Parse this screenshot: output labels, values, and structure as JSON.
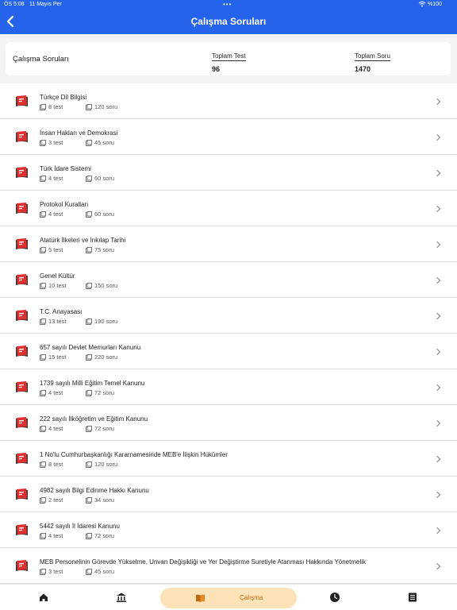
{
  "status_bar": {
    "time": "ÖS 5:08",
    "date": "11 Mayıs Per",
    "battery": "%100"
  },
  "header": {
    "title": "Çalışma Soruları"
  },
  "summary": {
    "title": "Çalışma Soruları",
    "total_test_label": "Toplam Test",
    "total_test_value": "96",
    "total_question_label": "Toplam Soru",
    "total_question_value": "1470"
  },
  "colors": {
    "primary": "#2563eb",
    "book_red": "#e03131",
    "active_tab_bg": "#fde3b8",
    "active_tab_text": "#c06a13"
  },
  "icons": {
    "back": "chevron-left-icon",
    "item": "book-icon",
    "row": "chevron-right-icon"
  },
  "items": [
    {
      "name": "Türkçe Dil Bilgisi",
      "tests": "8 test",
      "questions": "120 soru"
    },
    {
      "name": "İnsan Hakları ve Demokrasi",
      "tests": "3 test",
      "questions": "45 soru"
    },
    {
      "name": "Türk İdare Sistemi",
      "tests": "4 test",
      "questions": "60 soru"
    },
    {
      "name": "Protokol Kuralları",
      "tests": "4 test",
      "questions": "60 soru"
    },
    {
      "name": "Atatürk İlkeleri ve İnkılap Tarihi",
      "tests": "5 test",
      "questions": "75 soru"
    },
    {
      "name": "Genel Kültür",
      "tests": "10 test",
      "questions": "150 soru"
    },
    {
      "name": "T.C. Anayasası",
      "tests": "13 test",
      "questions": "190 soru"
    },
    {
      "name": "657 sayılı Devlet Memurları Kanunu",
      "tests": "15 test",
      "questions": "220 soru"
    },
    {
      "name": "1739 sayılı Milli Eğitim Temel Kanunu",
      "tests": "4 test",
      "questions": "72 soru"
    },
    {
      "name": "222 sayılı İlköğretim ve Eğitim Kanunu",
      "tests": "4 test",
      "questions": "72 soru"
    },
    {
      "name": "1 No'lu Cumhurbaşkanlığı Kararnamesinde MEB'e İlişkin Hükümler",
      "tests": "8 test",
      "questions": "120 soru"
    },
    {
      "name": "4982 sayılı Bilgi Edinme Hakkı Kanunu",
      "tests": "2 test",
      "questions": "34 soru"
    },
    {
      "name": "5442 sayılı İl İdaresi Kanunu",
      "tests": "4 test",
      "questions": "72 soru"
    },
    {
      "name": "MEB Personelinin Görevde Yükselme, Unvan Değişikliği ve Yer Değiştirme Suretiyle Atanması Hakkında Yönetmelik",
      "tests": "3 test",
      "questions": "45 soru"
    }
  ],
  "tabbar": {
    "active_label": "Çalışma"
  }
}
